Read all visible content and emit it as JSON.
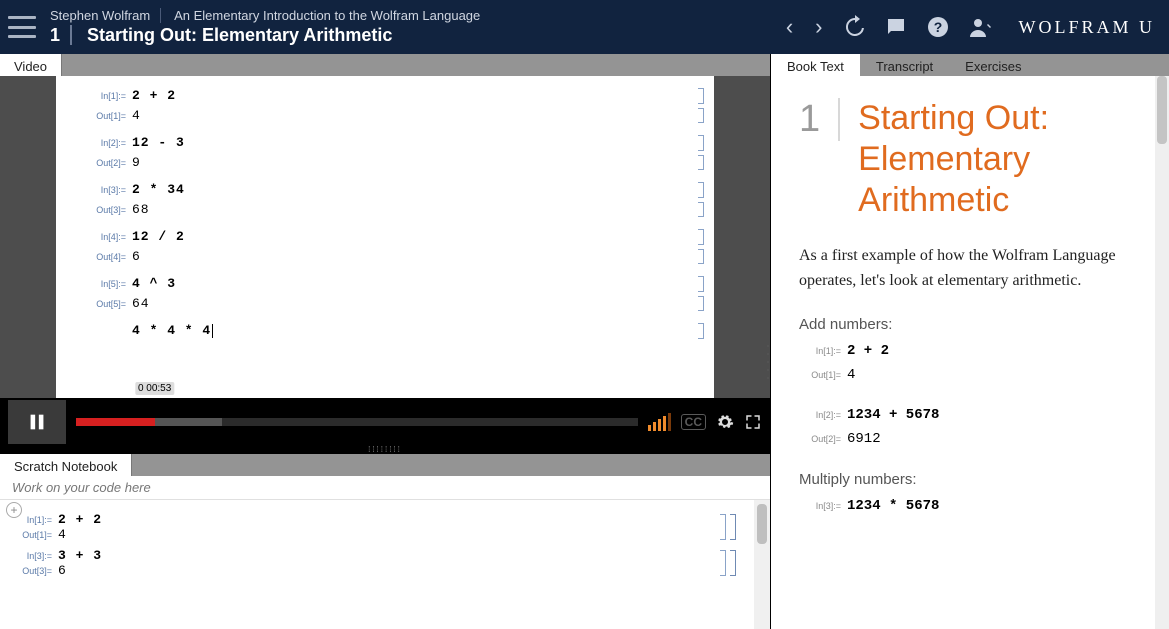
{
  "header": {
    "author": "Stephen Wolfram",
    "book": "An Elementary Introduction to the Wolfram Language",
    "chapter_num": "1",
    "chapter_title": "Starting Out: Elementary Arithmetic",
    "brand": "WOLFRAM U"
  },
  "left_tabs": {
    "video": "Video"
  },
  "video_notebook": {
    "rows": [
      {
        "in_lbl": "In[1]:=",
        "in_val": "2 + 2",
        "out_lbl": "Out[1]=",
        "out_val": "4"
      },
      {
        "in_lbl": "In[2]:=",
        "in_val": "12 - 3",
        "out_lbl": "Out[2]=",
        "out_val": "9"
      },
      {
        "in_lbl": "In[3]:=",
        "in_val": "2 * 34",
        "out_lbl": "Out[3]=",
        "out_val": "68"
      },
      {
        "in_lbl": "In[4]:=",
        "in_val": "12 / 2",
        "out_lbl": "Out[4]=",
        "out_val": "6"
      },
      {
        "in_lbl": "In[5]:=",
        "in_val": "4 ^ 3",
        "out_lbl": "Out[5]=",
        "out_val": "64"
      }
    ],
    "cursor_line": "4 * 4 * 4"
  },
  "video_controls": {
    "time_left": "0",
    "time_right": "00:53",
    "cc": "CC"
  },
  "scratch": {
    "tab": "Scratch Notebook",
    "hint": "Work on your code here",
    "rows": [
      {
        "in_lbl": "In[1]:=",
        "in_val": "2 + 2",
        "out_lbl": "Out[1]=",
        "out_val": "4"
      },
      {
        "in_lbl": "In[3]:=",
        "in_val": "3 + 3",
        "out_lbl": "Out[3]=",
        "out_val": "6"
      }
    ]
  },
  "right_tabs": {
    "book": "Book Text",
    "transcript": "Transcript",
    "exercises": "Exercises"
  },
  "book": {
    "num": "1",
    "title": "Starting Out: Elementary Arithmetic",
    "intro": "As a first example of how the Wolfram Language operates, let's look at elementary arithmetic.",
    "add_label": "Add numbers:",
    "mul_label": "Multiply numbers:",
    "ex1": {
      "in_lbl": "In[1]:=",
      "in_val": "2 + 2",
      "out_lbl": "Out[1]=",
      "out_val": "4"
    },
    "ex2": {
      "in_lbl": "In[2]:=",
      "in_val": "1234 + 5678",
      "out_lbl": "Out[2]=",
      "out_val": "6912"
    },
    "ex3": {
      "in_lbl": "In[3]:=",
      "in_val": "1234 * 5678"
    }
  }
}
